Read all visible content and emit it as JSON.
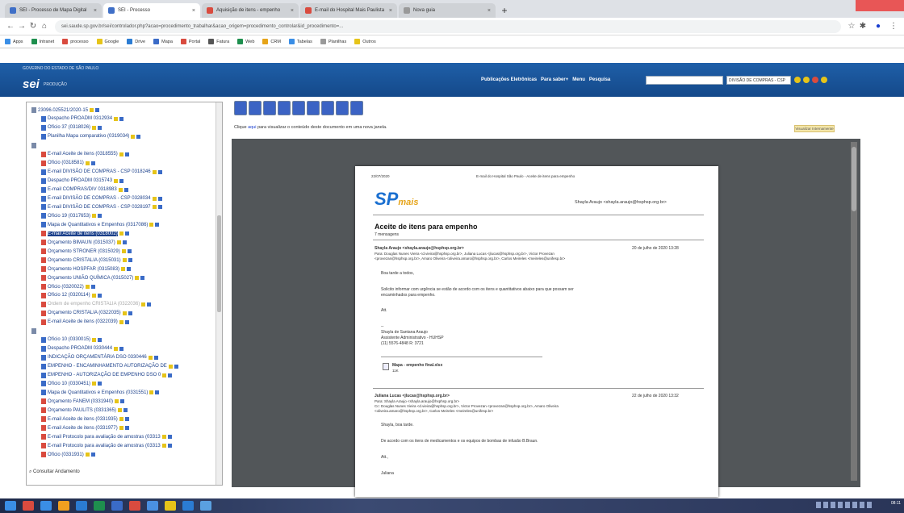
{
  "browser": {
    "tabs": [
      {
        "title": "SEI - Processo de Mapa Digital",
        "fav": "#3f6fc7",
        "active": false
      },
      {
        "title": "SEI - Processo",
        "fav": "#3f6fc7",
        "active": true
      },
      {
        "title": "Aquisição de itens - empenho",
        "fav": "#d94b3f",
        "active": false
      },
      {
        "title": "E-mail do Hospital Mais Paulista",
        "fav": "#d94b3f",
        "active": false
      },
      {
        "title": "Nova guia",
        "fav": "#999999",
        "active": false
      }
    ],
    "url": "sei.saude.sp.gov.br/sei/controlador.php?acao=procedimento_trabalhar&acao_origem=procedimento_controlar&id_procedimento=...",
    "bookmarks": [
      "Apps",
      "Intranet",
      "processo",
      "Google",
      "Drive",
      "Mapa",
      "Portal",
      "Fatura",
      "Web",
      "CRM",
      "Tabelas",
      "Planilhas",
      "Outros"
    ]
  },
  "sei": {
    "org": "GOVERNO DO ESTADO DE SÃO PAULO",
    "logo": "sei",
    "unit": "PRODUÇÃO",
    "menu": [
      "Publicações Eletrônicas",
      "Para saber+",
      "Menu",
      "Pesquisa"
    ],
    "unit_select": "DIVISÃO DE COMPRAS - CSP",
    "header_icons": [
      "#e6c419",
      "#e6c419",
      "#d94b3f",
      "#e6c419"
    ]
  },
  "tree": {
    "nodes": [
      {
        "label": "23096.025521/2020-15",
        "indent": 0,
        "kind": "root"
      },
      {
        "label": "Despacho PROADM 0312934",
        "indent": 1,
        "kind": "doc"
      },
      {
        "label": "Ofício 37 (0318026)",
        "indent": 1,
        "kind": "doc"
      },
      {
        "label": "Planilha Mapa comparativo (0319034)",
        "indent": 1,
        "kind": "doc"
      },
      {
        "label": "",
        "indent": 0,
        "kind": "folder"
      },
      {
        "label": "E-mail Aceite de itens (0318555)",
        "indent": 1,
        "kind": "pdf"
      },
      {
        "label": "Ofício (0318581)",
        "indent": 1,
        "kind": "pdf"
      },
      {
        "label": "E-mail DIVISÃO DE COMPRAS - CSP 0318246",
        "indent": 1,
        "kind": "doc"
      },
      {
        "label": "Despacho PROADM 0315743",
        "indent": 1,
        "kind": "doc"
      },
      {
        "label": "E-mail COMPRAS/DIV 0318983",
        "indent": 1,
        "kind": "doc"
      },
      {
        "label": "E-mail DIVISÃO DE COMPRAS - CSP 0328034",
        "indent": 1,
        "kind": "doc"
      },
      {
        "label": "E-mail DIVISÃO DE COMPRAS - CSP 0328197",
        "indent": 1,
        "kind": "doc"
      },
      {
        "label": "Ofício 19 (0317653)",
        "indent": 1,
        "kind": "doc"
      },
      {
        "label": "Mapa de Quantitativos e Empenhos (0317086)",
        "indent": 1,
        "kind": "doc"
      },
      {
        "label": "E-mail Aceite de itens (0318002)",
        "indent": 1,
        "kind": "pdf",
        "selected": true
      },
      {
        "label": "Orçamento BIMAUN (0315037)",
        "indent": 1,
        "kind": "pdf"
      },
      {
        "label": "Orçamento STRONER (0315029)",
        "indent": 1,
        "kind": "pdf"
      },
      {
        "label": "Orçamento CRISTALIA (0315031)",
        "indent": 1,
        "kind": "pdf"
      },
      {
        "label": "Orçamento HOSPFAR (0315083)",
        "indent": 1,
        "kind": "pdf"
      },
      {
        "label": "Orçamento UNIÃO QUÍMICA (0315027)",
        "indent": 1,
        "kind": "pdf"
      },
      {
        "label": "Ofício (0320022)",
        "indent": 1,
        "kind": "pdf"
      },
      {
        "label": "Ofício 12 (0320114)",
        "indent": 1,
        "kind": "pdf"
      },
      {
        "label": "Ordem de empenho CRISTALIA (0322036)",
        "indent": 1,
        "kind": "pdf",
        "grey": true
      },
      {
        "label": "Orçamento CRISTALIA (0322035)",
        "indent": 1,
        "kind": "pdf"
      },
      {
        "label": "E-mail Aceite de itens (0322039)",
        "indent": 1,
        "kind": "pdf"
      },
      {
        "label": "",
        "indent": 0,
        "kind": "folder"
      },
      {
        "label": "Ofício 10 (0330015)",
        "indent": 1,
        "kind": "doc"
      },
      {
        "label": "Despacho PROADM 0330444",
        "indent": 1,
        "kind": "doc"
      },
      {
        "label": "INDICAÇÃO ORÇAMENTÁRIA DSO 0330446",
        "indent": 1,
        "kind": "doc"
      },
      {
        "label": "EMPENHO - ENCAMINHAMENTO AUTORIZAÇÃO DE",
        "indent": 1,
        "kind": "doc"
      },
      {
        "label": "EMPENHO - AUTORIZAÇÃO DE EMPENHO DSO 0",
        "indent": 1,
        "kind": "doc"
      },
      {
        "label": "Ofício 10 (0330451)",
        "indent": 1,
        "kind": "doc"
      },
      {
        "label": "Mapa de Quantitativos e Empenhos (0331551)",
        "indent": 1,
        "kind": "doc"
      },
      {
        "label": "Orçamento FANEM (0331940)",
        "indent": 1,
        "kind": "pdf"
      },
      {
        "label": "Orçamento PAULITS (0331365)",
        "indent": 1,
        "kind": "pdf"
      },
      {
        "label": "E-mail Aceite de itens (0331935)",
        "indent": 1,
        "kind": "pdf"
      },
      {
        "label": "E-mail Aceite de itens (0331977)",
        "indent": 1,
        "kind": "pdf"
      },
      {
        "label": "E-mail Protocolo para avaliação de amostras (03313",
        "indent": 1,
        "kind": "pdf"
      },
      {
        "label": "E-mail Protocolo para avaliação de amostras (03313",
        "indent": 1,
        "kind": "pdf"
      },
      {
        "label": "Ofício (0331931)",
        "indent": 1,
        "kind": "pdf"
      }
    ],
    "consultar": "Consultar Andamento"
  },
  "viewer": {
    "toolbar_icons": [
      "document-icon",
      "info-icon",
      "view-icon",
      "sign-icon",
      "print-icon",
      "folder-icon",
      "mail-icon",
      "send-icon",
      "process-icon"
    ],
    "hint_pre": "Clique",
    "hint_link": "aqui",
    "hint_post": "para visualizar o conteúdo deste documento em uma nova janela.",
    "hint_button": "Visualizar Internamente",
    "email": {
      "hdr_left": "22/07/2020",
      "hdr_right": "E-mail do Hospital São Paulo - Aceite de itens para empenho",
      "logo_sp": "SP",
      "logo_mais": "mais",
      "owner": "Shayla Araujo <shayla.araujo@hsphsp.org.br>",
      "subject": "Aceite de itens para empenho",
      "count": "7 mensagens",
      "m1_from": "Shayla Araujo <shayla.araujo@hsphsp.org.br>",
      "m1_date": "20 de julho de 2020 13:28",
      "m1_to1": "Para: Douglas Nunes Vieira <d.vieira@hsphsp.org.br>, Juliana Lucas <jlucas@hsphsp.org.br>, Victor Provezan",
      "m1_to2": "<provezan@hsphsp.org.br>, Amaro Oliveira <oliveira.amaro@hsphsp.org.br>, Carlos Meireles <meireles@unifesp.br>",
      "m1_greet": "Boa tarde a todos,",
      "m1_body1": "Solicito informar com urgência se estão de acordo com os itens e quantitativos abaixo para que possam ser",
      "m1_body2": "encaminhados para empenho.",
      "m1_att": "Att.",
      "m1_dash": "--",
      "m1_sig1": "Shayla de Santana Araujo",
      "m1_sig2": "Assistente Administrativo - HUHSP",
      "m1_sig3": "(11) 5576-4848 R: 3721",
      "attach_name": "Mapa - empenho final.xlsx",
      "attach_size": "11K",
      "m2_from": "Juliana Lucas <jlucas@hsphsp.org.br>",
      "m2_date": "22 de julho de 2020 13:32",
      "m2_to1": "Para: Shayla Araujo <shayla.araujo@hsphsp.org.br>",
      "m2_to2": "Cc: Douglas Nunes Vieira <d.vieira@hsphsp.org.br>, Victor Provezan <provezan@hsphsp.org.br>, Amaro Oliveira",
      "m2_to3": "<oliveira.amaro@hsphsp.org.br>, Carlos Meireles <meireles@unifesp.br>",
      "m2_greet": "Shayla, boa tarde.",
      "m2_body": "De acordo com os itens de medicamentos e os equipos de bombas de infusão B.Braun.",
      "m2_att": "Att.,",
      "m2_sig": "Juliana"
    }
  },
  "taskbar": {
    "apps": [
      "#3a8ee6",
      "#d94b3f",
      "#3a8ee6",
      "#f0a020",
      "#2b7cd3",
      "#1e8f4e",
      "#3a6bc7",
      "#d94b3f",
      "#4a90e2",
      "#e6c419",
      "#2b7cd3",
      "#5aa0e0"
    ],
    "clock": "08:11"
  }
}
